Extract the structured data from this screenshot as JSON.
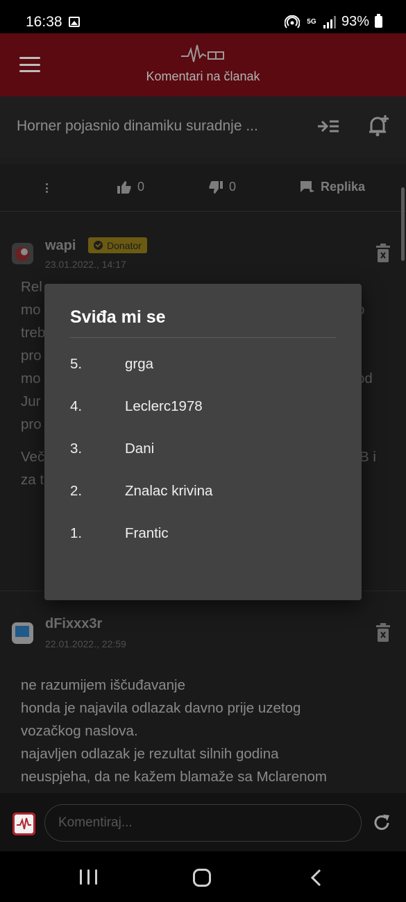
{
  "status_bar": {
    "time": "16:38",
    "network": "5G",
    "battery": "93%"
  },
  "header": {
    "title": "Komentari na članak",
    "accent_color": "#5a0a10"
  },
  "article": {
    "title": "Horner pojasnio dinamiku suradnje ..."
  },
  "actions": {
    "likes": "0",
    "dislikes": "0",
    "reply_label": "Replika"
  },
  "comments": [
    {
      "author": "wapi",
      "badge": "Donator",
      "date": "23.01.2022., 14:17",
      "lines": [
        "Rel",
        "mo",
        "treb",
        "pro",
        "mo",
        "Jur",
        "pro",
        "",
        "Več",
        "za t"
      ],
      "line_ends": [
        "o",
        "od",
        "B i"
      ],
      "reply_side": "a"
    },
    {
      "author": "dFixxx3r",
      "date": "22.01.2022., 22:59",
      "lines": [
        "ne razumijem iščuđavanje",
        "honda je najavila odlazak davno prije uzetog",
        "vozačkog naslova.",
        "najavljen odlazak je rezultat silnih godina",
        "neuspjeha, da ne kažem blamaže sa Mclarenom"
      ]
    }
  ],
  "comment_input": {
    "placeholder": "Komentiraj..."
  },
  "likes_modal": {
    "title": "Sviđa mi se",
    "entries": [
      {
        "rank": "5.",
        "user": "grga"
      },
      {
        "rank": "4.",
        "user": "Leclerc1978"
      },
      {
        "rank": "3.",
        "user": "Dani"
      },
      {
        "rank": "2.",
        "user": "Znalac krivina"
      },
      {
        "rank": "1.",
        "user": "Frantic"
      }
    ]
  }
}
